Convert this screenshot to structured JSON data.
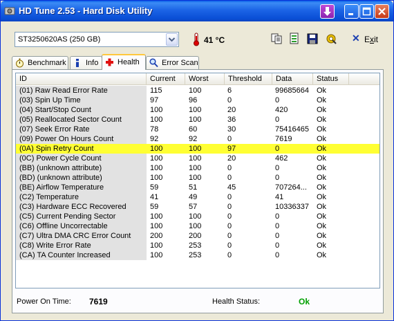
{
  "window": {
    "title": "HD Tune 2.53 - Hard Disk Utility"
  },
  "toolbar": {
    "drive": "ST3250620AS (250 GB)",
    "temperature": "41 °C",
    "exit_label_prefix": "E",
    "exit_label_underlined": "x",
    "exit_label_suffix": "it"
  },
  "tabs": [
    {
      "label": "Benchmark",
      "icon": "stopwatch-icon"
    },
    {
      "label": "Info",
      "icon": "info-icon"
    },
    {
      "label": "Health",
      "icon": "red-cross-icon",
      "active": true
    },
    {
      "label": "Error Scan",
      "icon": "magnifier-icon"
    }
  ],
  "table": {
    "columns": [
      "ID",
      "Current",
      "Worst",
      "Threshold",
      "Data",
      "Status"
    ],
    "rows": [
      {
        "id": "(01) Raw Read Error Rate",
        "current": "115",
        "worst": "100",
        "threshold": "6",
        "data": "99685664",
        "status": "Ok"
      },
      {
        "id": "(03) Spin Up Time",
        "current": "97",
        "worst": "96",
        "threshold": "0",
        "data": "0",
        "status": "Ok"
      },
      {
        "id": "(04) Start/Stop Count",
        "current": "100",
        "worst": "100",
        "threshold": "20",
        "data": "420",
        "status": "Ok"
      },
      {
        "id": "(05) Reallocated Sector Count",
        "current": "100",
        "worst": "100",
        "threshold": "36",
        "data": "0",
        "status": "Ok"
      },
      {
        "id": "(07) Seek Error Rate",
        "current": "78",
        "worst": "60",
        "threshold": "30",
        "data": "75416465",
        "status": "Ok"
      },
      {
        "id": "(09) Power On Hours Count",
        "current": "92",
        "worst": "92",
        "threshold": "0",
        "data": "7619",
        "status": "Ok"
      },
      {
        "id": "(0A) Spin Retry Count",
        "current": "100",
        "worst": "100",
        "threshold": "97",
        "data": "0",
        "status": "Ok",
        "highlight": true
      },
      {
        "id": "(0C) Power Cycle Count",
        "current": "100",
        "worst": "100",
        "threshold": "20",
        "data": "462",
        "status": "Ok"
      },
      {
        "id": "(BB) (unknown attribute)",
        "current": "100",
        "worst": "100",
        "threshold": "0",
        "data": "0",
        "status": "Ok"
      },
      {
        "id": "(BD) (unknown attribute)",
        "current": "100",
        "worst": "100",
        "threshold": "0",
        "data": "0",
        "status": "Ok"
      },
      {
        "id": "(BE) Airflow Temperature",
        "current": "59",
        "worst": "51",
        "threshold": "45",
        "data": "707264...",
        "status": "Ok"
      },
      {
        "id": "(C2) Temperature",
        "current": "41",
        "worst": "49",
        "threshold": "0",
        "data": "41",
        "status": "Ok"
      },
      {
        "id": "(C3) Hardware ECC Recovered",
        "current": "59",
        "worst": "57",
        "threshold": "0",
        "data": "10336337",
        "status": "Ok"
      },
      {
        "id": "(C5) Current Pending Sector",
        "current": "100",
        "worst": "100",
        "threshold": "0",
        "data": "0",
        "status": "Ok"
      },
      {
        "id": "(C6) Offline Uncorrectable",
        "current": "100",
        "worst": "100",
        "threshold": "0",
        "data": "0",
        "status": "Ok"
      },
      {
        "id": "(C7) Ultra DMA CRC Error Count",
        "current": "200",
        "worst": "200",
        "threshold": "0",
        "data": "0",
        "status": "Ok"
      },
      {
        "id": "(C8) Write Error Rate",
        "current": "100",
        "worst": "253",
        "threshold": "0",
        "data": "0",
        "status": "Ok"
      },
      {
        "id": "(CA) TA Counter Increased",
        "current": "100",
        "worst": "253",
        "threshold": "0",
        "data": "0",
        "status": "Ok"
      }
    ]
  },
  "footer": {
    "power_on_label": "Power On Time:",
    "power_on_value": "7619",
    "health_label": "Health Status:",
    "health_value": "Ok"
  },
  "colors": {
    "highlight": "#ffff33",
    "health_ok": "#00a000",
    "title_bar": "#0a4fd6"
  }
}
